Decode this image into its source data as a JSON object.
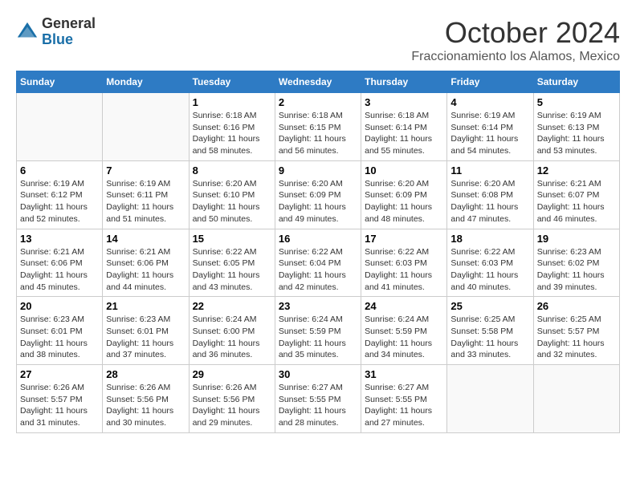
{
  "logo": {
    "general": "General",
    "blue": "Blue"
  },
  "title": "October 2024",
  "location": "Fraccionamiento los Alamos, Mexico",
  "days_of_week": [
    "Sunday",
    "Monday",
    "Tuesday",
    "Wednesday",
    "Thursday",
    "Friday",
    "Saturday"
  ],
  "weeks": [
    [
      {
        "day": "",
        "info": ""
      },
      {
        "day": "",
        "info": ""
      },
      {
        "day": "1",
        "info": "Sunrise: 6:18 AM\nSunset: 6:16 PM\nDaylight: 11 hours\nand 58 minutes."
      },
      {
        "day": "2",
        "info": "Sunrise: 6:18 AM\nSunset: 6:15 PM\nDaylight: 11 hours\nand 56 minutes."
      },
      {
        "day": "3",
        "info": "Sunrise: 6:18 AM\nSunset: 6:14 PM\nDaylight: 11 hours\nand 55 minutes."
      },
      {
        "day": "4",
        "info": "Sunrise: 6:19 AM\nSunset: 6:14 PM\nDaylight: 11 hours\nand 54 minutes."
      },
      {
        "day": "5",
        "info": "Sunrise: 6:19 AM\nSunset: 6:13 PM\nDaylight: 11 hours\nand 53 minutes."
      }
    ],
    [
      {
        "day": "6",
        "info": "Sunrise: 6:19 AM\nSunset: 6:12 PM\nDaylight: 11 hours\nand 52 minutes."
      },
      {
        "day": "7",
        "info": "Sunrise: 6:19 AM\nSunset: 6:11 PM\nDaylight: 11 hours\nand 51 minutes."
      },
      {
        "day": "8",
        "info": "Sunrise: 6:20 AM\nSunset: 6:10 PM\nDaylight: 11 hours\nand 50 minutes."
      },
      {
        "day": "9",
        "info": "Sunrise: 6:20 AM\nSunset: 6:09 PM\nDaylight: 11 hours\nand 49 minutes."
      },
      {
        "day": "10",
        "info": "Sunrise: 6:20 AM\nSunset: 6:09 PM\nDaylight: 11 hours\nand 48 minutes."
      },
      {
        "day": "11",
        "info": "Sunrise: 6:20 AM\nSunset: 6:08 PM\nDaylight: 11 hours\nand 47 minutes."
      },
      {
        "day": "12",
        "info": "Sunrise: 6:21 AM\nSunset: 6:07 PM\nDaylight: 11 hours\nand 46 minutes."
      }
    ],
    [
      {
        "day": "13",
        "info": "Sunrise: 6:21 AM\nSunset: 6:06 PM\nDaylight: 11 hours\nand 45 minutes."
      },
      {
        "day": "14",
        "info": "Sunrise: 6:21 AM\nSunset: 6:06 PM\nDaylight: 11 hours\nand 44 minutes."
      },
      {
        "day": "15",
        "info": "Sunrise: 6:22 AM\nSunset: 6:05 PM\nDaylight: 11 hours\nand 43 minutes."
      },
      {
        "day": "16",
        "info": "Sunrise: 6:22 AM\nSunset: 6:04 PM\nDaylight: 11 hours\nand 42 minutes."
      },
      {
        "day": "17",
        "info": "Sunrise: 6:22 AM\nSunset: 6:03 PM\nDaylight: 11 hours\nand 41 minutes."
      },
      {
        "day": "18",
        "info": "Sunrise: 6:22 AM\nSunset: 6:03 PM\nDaylight: 11 hours\nand 40 minutes."
      },
      {
        "day": "19",
        "info": "Sunrise: 6:23 AM\nSunset: 6:02 PM\nDaylight: 11 hours\nand 39 minutes."
      }
    ],
    [
      {
        "day": "20",
        "info": "Sunrise: 6:23 AM\nSunset: 6:01 PM\nDaylight: 11 hours\nand 38 minutes."
      },
      {
        "day": "21",
        "info": "Sunrise: 6:23 AM\nSunset: 6:01 PM\nDaylight: 11 hours\nand 37 minutes."
      },
      {
        "day": "22",
        "info": "Sunrise: 6:24 AM\nSunset: 6:00 PM\nDaylight: 11 hours\nand 36 minutes."
      },
      {
        "day": "23",
        "info": "Sunrise: 6:24 AM\nSunset: 5:59 PM\nDaylight: 11 hours\nand 35 minutes."
      },
      {
        "day": "24",
        "info": "Sunrise: 6:24 AM\nSunset: 5:59 PM\nDaylight: 11 hours\nand 34 minutes."
      },
      {
        "day": "25",
        "info": "Sunrise: 6:25 AM\nSunset: 5:58 PM\nDaylight: 11 hours\nand 33 minutes."
      },
      {
        "day": "26",
        "info": "Sunrise: 6:25 AM\nSunset: 5:57 PM\nDaylight: 11 hours\nand 32 minutes."
      }
    ],
    [
      {
        "day": "27",
        "info": "Sunrise: 6:26 AM\nSunset: 5:57 PM\nDaylight: 11 hours\nand 31 minutes."
      },
      {
        "day": "28",
        "info": "Sunrise: 6:26 AM\nSunset: 5:56 PM\nDaylight: 11 hours\nand 30 minutes."
      },
      {
        "day": "29",
        "info": "Sunrise: 6:26 AM\nSunset: 5:56 PM\nDaylight: 11 hours\nand 29 minutes."
      },
      {
        "day": "30",
        "info": "Sunrise: 6:27 AM\nSunset: 5:55 PM\nDaylight: 11 hours\nand 28 minutes."
      },
      {
        "day": "31",
        "info": "Sunrise: 6:27 AM\nSunset: 5:55 PM\nDaylight: 11 hours\nand 27 minutes."
      },
      {
        "day": "",
        "info": ""
      },
      {
        "day": "",
        "info": ""
      }
    ]
  ]
}
